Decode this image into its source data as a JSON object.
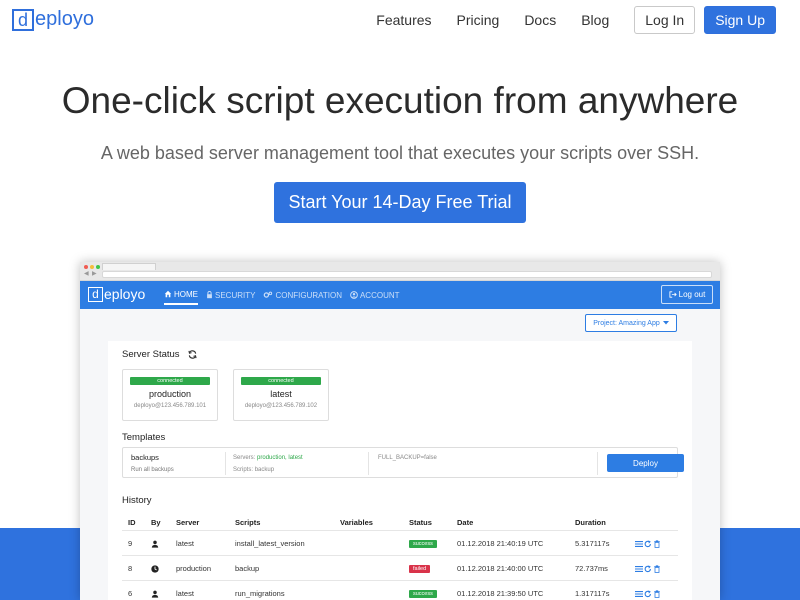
{
  "nav": {
    "logo_letter": "d",
    "logo_rest": "eployo",
    "links": [
      "Features",
      "Pricing",
      "Docs",
      "Blog"
    ],
    "login": "Log In",
    "signup": "Sign Up"
  },
  "hero": {
    "title": "One-click script execution from anywhere",
    "subtitle": "A web based server management tool that executes your scripts over SSH.",
    "cta": "Start Your 14-Day Free Trial"
  },
  "app": {
    "logo_letter": "d",
    "logo_rest": "eployo",
    "nav": [
      {
        "label": "HOME",
        "icon": "home-icon",
        "active": true
      },
      {
        "label": "SECURITY",
        "icon": "lock-icon",
        "active": false
      },
      {
        "label": "CONFIGURATION",
        "icon": "cogs-icon",
        "active": false
      },
      {
        "label": "ACCOUNT",
        "icon": "user-circle-icon",
        "active": false
      }
    ],
    "logout": "Log out",
    "project_select": "Project: Amazing App",
    "server_status_title": "Server Status",
    "servers": [
      {
        "status": "connected",
        "name": "production",
        "host": "deployo@123.456.789.101"
      },
      {
        "status": "connected",
        "name": "latest",
        "host": "deployo@123.456.789.102"
      }
    ],
    "templates_title": "Templates",
    "template": {
      "name": "backups",
      "description": "Run all backups",
      "servers_label": "Servers:",
      "servers_value": "production, latest",
      "scripts_label": "Scripts:",
      "scripts_value": "backup",
      "variables": "FULL_BACKUP=false",
      "deploy": "Deploy"
    },
    "history_title": "History",
    "history_columns": [
      "ID",
      "By",
      "Server",
      "Scripts",
      "Variables",
      "Status",
      "Date",
      "Duration"
    ],
    "history_rows": [
      {
        "id": "9",
        "by": "user-icon",
        "server": "latest",
        "scripts": "install_latest_version",
        "variables": "",
        "status": "success",
        "date": "01.12.2018 21:40:19 UTC",
        "duration": "5.317117s"
      },
      {
        "id": "8",
        "by": "clock-icon",
        "server": "production",
        "scripts": "backup",
        "variables": "",
        "status": "failed",
        "date": "01.12.2018 21:40:00 UTC",
        "duration": "72.737ms"
      },
      {
        "id": "6",
        "by": "user-icon",
        "server": "latest",
        "scripts": "run_migrations",
        "variables": "",
        "status": "success",
        "date": "01.12.2018 21:39:50 UTC",
        "duration": "1.317117s"
      }
    ]
  },
  "colors": {
    "brand_blue": "#2f72de",
    "app_bar_blue": "#2d7de3",
    "success_green": "#2ea84a",
    "failed_red": "#d9334a"
  }
}
